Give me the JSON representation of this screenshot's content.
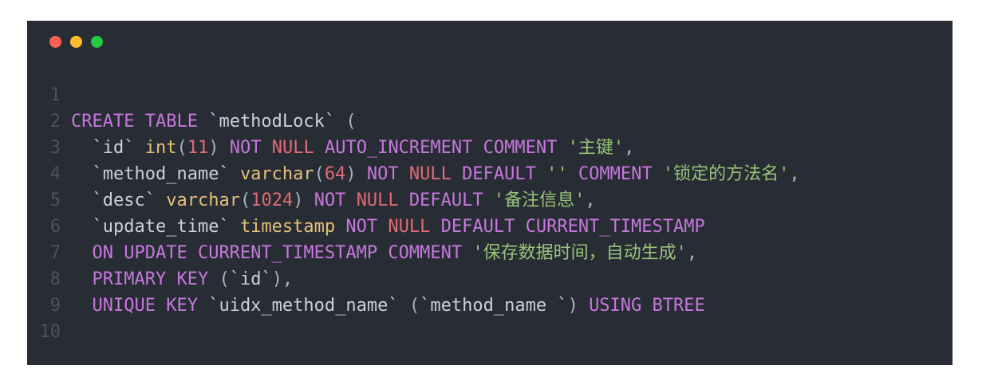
{
  "window": {
    "controls": [
      {
        "name": "close",
        "color": "#ff5f56"
      },
      {
        "name": "minimize",
        "color": "#ffbd2e"
      },
      {
        "name": "maximize",
        "color": "#27c93f"
      }
    ]
  },
  "theme": {
    "identifier": "#c9d1dc",
    "keyword": "#c678dd",
    "null": "#e06c75",
    "type": "#e5c07b",
    "number": "#e06c75",
    "string": "#98c379",
    "punct": "#abb2bf",
    "line_number": "#4b5263"
  },
  "code_lines": [
    {
      "num": "1",
      "tokens": []
    },
    {
      "num": "2",
      "tokens": [
        {
          "t": "CREATE TABLE",
          "k": "keyword"
        },
        {
          "t": " ",
          "k": "punct"
        },
        {
          "t": "`methodLock`",
          "k": "identifier"
        },
        {
          "t": " (",
          "k": "punct"
        }
      ]
    },
    {
      "num": "3",
      "tokens": [
        {
          "t": "  ",
          "k": "punct"
        },
        {
          "t": "`id`",
          "k": "identifier"
        },
        {
          "t": " ",
          "k": "punct"
        },
        {
          "t": "int",
          "k": "type"
        },
        {
          "t": "(",
          "k": "punct"
        },
        {
          "t": "11",
          "k": "number"
        },
        {
          "t": ") ",
          "k": "punct"
        },
        {
          "t": "NOT",
          "k": "keyword"
        },
        {
          "t": " ",
          "k": "punct"
        },
        {
          "t": "NULL",
          "k": "null"
        },
        {
          "t": " ",
          "k": "punct"
        },
        {
          "t": "AUTO_INCREMENT COMMENT",
          "k": "keyword"
        },
        {
          "t": " ",
          "k": "punct"
        },
        {
          "t": "'主键'",
          "k": "string"
        },
        {
          "t": ",",
          "k": "punct"
        }
      ]
    },
    {
      "num": "4",
      "tokens": [
        {
          "t": "  ",
          "k": "punct"
        },
        {
          "t": "`method_name`",
          "k": "identifier"
        },
        {
          "t": " ",
          "k": "punct"
        },
        {
          "t": "varchar",
          "k": "type"
        },
        {
          "t": "(",
          "k": "punct"
        },
        {
          "t": "64",
          "k": "number"
        },
        {
          "t": ") ",
          "k": "punct"
        },
        {
          "t": "NOT",
          "k": "keyword"
        },
        {
          "t": " ",
          "k": "punct"
        },
        {
          "t": "NULL",
          "k": "null"
        },
        {
          "t": " ",
          "k": "punct"
        },
        {
          "t": "DEFAULT",
          "k": "keyword"
        },
        {
          "t": " ",
          "k": "punct"
        },
        {
          "t": "''",
          "k": "string"
        },
        {
          "t": " ",
          "k": "punct"
        },
        {
          "t": "COMMENT",
          "k": "keyword"
        },
        {
          "t": " ",
          "k": "punct"
        },
        {
          "t": "'锁定的方法名'",
          "k": "string"
        },
        {
          "t": ",",
          "k": "punct"
        }
      ]
    },
    {
      "num": "5",
      "tokens": [
        {
          "t": "  ",
          "k": "punct"
        },
        {
          "t": "`desc`",
          "k": "identifier"
        },
        {
          "t": " ",
          "k": "punct"
        },
        {
          "t": "varchar",
          "k": "type"
        },
        {
          "t": "(",
          "k": "punct"
        },
        {
          "t": "1024",
          "k": "number"
        },
        {
          "t": ") ",
          "k": "punct"
        },
        {
          "t": "NOT",
          "k": "keyword"
        },
        {
          "t": " ",
          "k": "punct"
        },
        {
          "t": "NULL",
          "k": "null"
        },
        {
          "t": " ",
          "k": "punct"
        },
        {
          "t": "DEFAULT",
          "k": "keyword"
        },
        {
          "t": " ",
          "k": "punct"
        },
        {
          "t": "'备注信息'",
          "k": "string"
        },
        {
          "t": ",",
          "k": "punct"
        }
      ]
    },
    {
      "num": "6",
      "tokens": [
        {
          "t": "  ",
          "k": "punct"
        },
        {
          "t": "`update_time`",
          "k": "identifier"
        },
        {
          "t": " ",
          "k": "punct"
        },
        {
          "t": "timestamp",
          "k": "type"
        },
        {
          "t": " ",
          "k": "punct"
        },
        {
          "t": "NOT",
          "k": "keyword"
        },
        {
          "t": " ",
          "k": "punct"
        },
        {
          "t": "NULL",
          "k": "null"
        },
        {
          "t": " ",
          "k": "punct"
        },
        {
          "t": "DEFAULT CURRENT_TIMESTAMP",
          "k": "keyword"
        }
      ]
    },
    {
      "num": "7",
      "tokens": [
        {
          "t": "  ",
          "k": "punct"
        },
        {
          "t": "ON UPDATE CURRENT_TIMESTAMP COMMENT",
          "k": "keyword"
        },
        {
          "t": " ",
          "k": "punct"
        },
        {
          "t": "'保存数据时间，自动生成'",
          "k": "string"
        },
        {
          "t": ",",
          "k": "punct"
        }
      ]
    },
    {
      "num": "8",
      "tokens": [
        {
          "t": "  ",
          "k": "punct"
        },
        {
          "t": "PRIMARY KEY",
          "k": "keyword"
        },
        {
          "t": " (",
          "k": "punct"
        },
        {
          "t": "`id`",
          "k": "identifier"
        },
        {
          "t": "),",
          "k": "punct"
        }
      ]
    },
    {
      "num": "9",
      "tokens": [
        {
          "t": "  ",
          "k": "punct"
        },
        {
          "t": "UNIQUE KEY",
          "k": "keyword"
        },
        {
          "t": " ",
          "k": "punct"
        },
        {
          "t": "`uidx_method_name`",
          "k": "identifier"
        },
        {
          "t": " (",
          "k": "punct"
        },
        {
          "t": "`method_name `",
          "k": "identifier"
        },
        {
          "t": ") ",
          "k": "punct"
        },
        {
          "t": "USING BTREE",
          "k": "keyword"
        }
      ]
    },
    {
      "num": "10",
      "tokens": []
    }
  ]
}
